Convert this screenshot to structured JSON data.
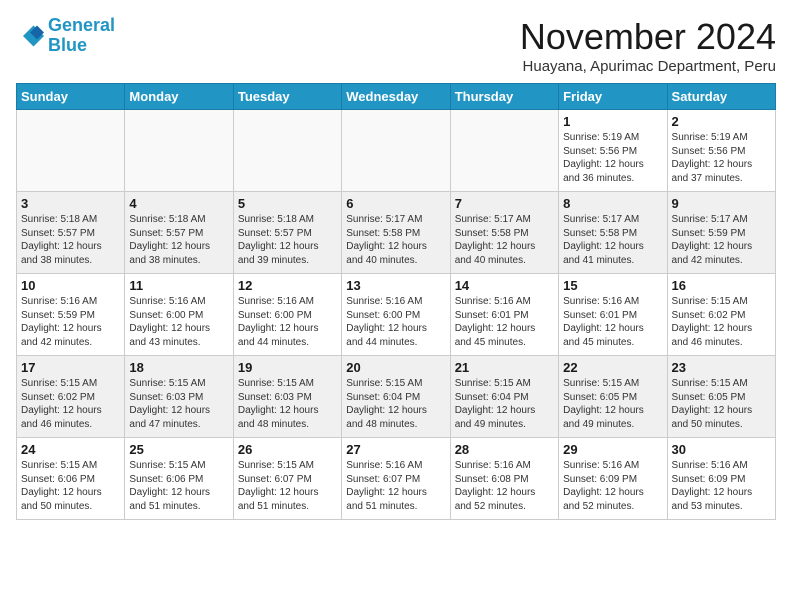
{
  "logo": {
    "line1": "General",
    "line2": "Blue"
  },
  "header": {
    "month": "November 2024",
    "location": "Huayana, Apurimac Department, Peru"
  },
  "weekdays": [
    "Sunday",
    "Monday",
    "Tuesday",
    "Wednesday",
    "Thursday",
    "Friday",
    "Saturday"
  ],
  "weeks": [
    [
      {
        "day": "",
        "info": ""
      },
      {
        "day": "",
        "info": ""
      },
      {
        "day": "",
        "info": ""
      },
      {
        "day": "",
        "info": ""
      },
      {
        "day": "",
        "info": ""
      },
      {
        "day": "1",
        "info": "Sunrise: 5:19 AM\nSunset: 5:56 PM\nDaylight: 12 hours\nand 36 minutes."
      },
      {
        "day": "2",
        "info": "Sunrise: 5:19 AM\nSunset: 5:56 PM\nDaylight: 12 hours\nand 37 minutes."
      }
    ],
    [
      {
        "day": "3",
        "info": "Sunrise: 5:18 AM\nSunset: 5:57 PM\nDaylight: 12 hours\nand 38 minutes."
      },
      {
        "day": "4",
        "info": "Sunrise: 5:18 AM\nSunset: 5:57 PM\nDaylight: 12 hours\nand 38 minutes."
      },
      {
        "day": "5",
        "info": "Sunrise: 5:18 AM\nSunset: 5:57 PM\nDaylight: 12 hours\nand 39 minutes."
      },
      {
        "day": "6",
        "info": "Sunrise: 5:17 AM\nSunset: 5:58 PM\nDaylight: 12 hours\nand 40 minutes."
      },
      {
        "day": "7",
        "info": "Sunrise: 5:17 AM\nSunset: 5:58 PM\nDaylight: 12 hours\nand 40 minutes."
      },
      {
        "day": "8",
        "info": "Sunrise: 5:17 AM\nSunset: 5:58 PM\nDaylight: 12 hours\nand 41 minutes."
      },
      {
        "day": "9",
        "info": "Sunrise: 5:17 AM\nSunset: 5:59 PM\nDaylight: 12 hours\nand 42 minutes."
      }
    ],
    [
      {
        "day": "10",
        "info": "Sunrise: 5:16 AM\nSunset: 5:59 PM\nDaylight: 12 hours\nand 42 minutes."
      },
      {
        "day": "11",
        "info": "Sunrise: 5:16 AM\nSunset: 6:00 PM\nDaylight: 12 hours\nand 43 minutes."
      },
      {
        "day": "12",
        "info": "Sunrise: 5:16 AM\nSunset: 6:00 PM\nDaylight: 12 hours\nand 44 minutes."
      },
      {
        "day": "13",
        "info": "Sunrise: 5:16 AM\nSunset: 6:00 PM\nDaylight: 12 hours\nand 44 minutes."
      },
      {
        "day": "14",
        "info": "Sunrise: 5:16 AM\nSunset: 6:01 PM\nDaylight: 12 hours\nand 45 minutes."
      },
      {
        "day": "15",
        "info": "Sunrise: 5:16 AM\nSunset: 6:01 PM\nDaylight: 12 hours\nand 45 minutes."
      },
      {
        "day": "16",
        "info": "Sunrise: 5:15 AM\nSunset: 6:02 PM\nDaylight: 12 hours\nand 46 minutes."
      }
    ],
    [
      {
        "day": "17",
        "info": "Sunrise: 5:15 AM\nSunset: 6:02 PM\nDaylight: 12 hours\nand 46 minutes."
      },
      {
        "day": "18",
        "info": "Sunrise: 5:15 AM\nSunset: 6:03 PM\nDaylight: 12 hours\nand 47 minutes."
      },
      {
        "day": "19",
        "info": "Sunrise: 5:15 AM\nSunset: 6:03 PM\nDaylight: 12 hours\nand 48 minutes."
      },
      {
        "day": "20",
        "info": "Sunrise: 5:15 AM\nSunset: 6:04 PM\nDaylight: 12 hours\nand 48 minutes."
      },
      {
        "day": "21",
        "info": "Sunrise: 5:15 AM\nSunset: 6:04 PM\nDaylight: 12 hours\nand 49 minutes."
      },
      {
        "day": "22",
        "info": "Sunrise: 5:15 AM\nSunset: 6:05 PM\nDaylight: 12 hours\nand 49 minutes."
      },
      {
        "day": "23",
        "info": "Sunrise: 5:15 AM\nSunset: 6:05 PM\nDaylight: 12 hours\nand 50 minutes."
      }
    ],
    [
      {
        "day": "24",
        "info": "Sunrise: 5:15 AM\nSunset: 6:06 PM\nDaylight: 12 hours\nand 50 minutes."
      },
      {
        "day": "25",
        "info": "Sunrise: 5:15 AM\nSunset: 6:06 PM\nDaylight: 12 hours\nand 51 minutes."
      },
      {
        "day": "26",
        "info": "Sunrise: 5:15 AM\nSunset: 6:07 PM\nDaylight: 12 hours\nand 51 minutes."
      },
      {
        "day": "27",
        "info": "Sunrise: 5:16 AM\nSunset: 6:07 PM\nDaylight: 12 hours\nand 51 minutes."
      },
      {
        "day": "28",
        "info": "Sunrise: 5:16 AM\nSunset: 6:08 PM\nDaylight: 12 hours\nand 52 minutes."
      },
      {
        "day": "29",
        "info": "Sunrise: 5:16 AM\nSunset: 6:09 PM\nDaylight: 12 hours\nand 52 minutes."
      },
      {
        "day": "30",
        "info": "Sunrise: 5:16 AM\nSunset: 6:09 PM\nDaylight: 12 hours\nand 53 minutes."
      }
    ]
  ]
}
